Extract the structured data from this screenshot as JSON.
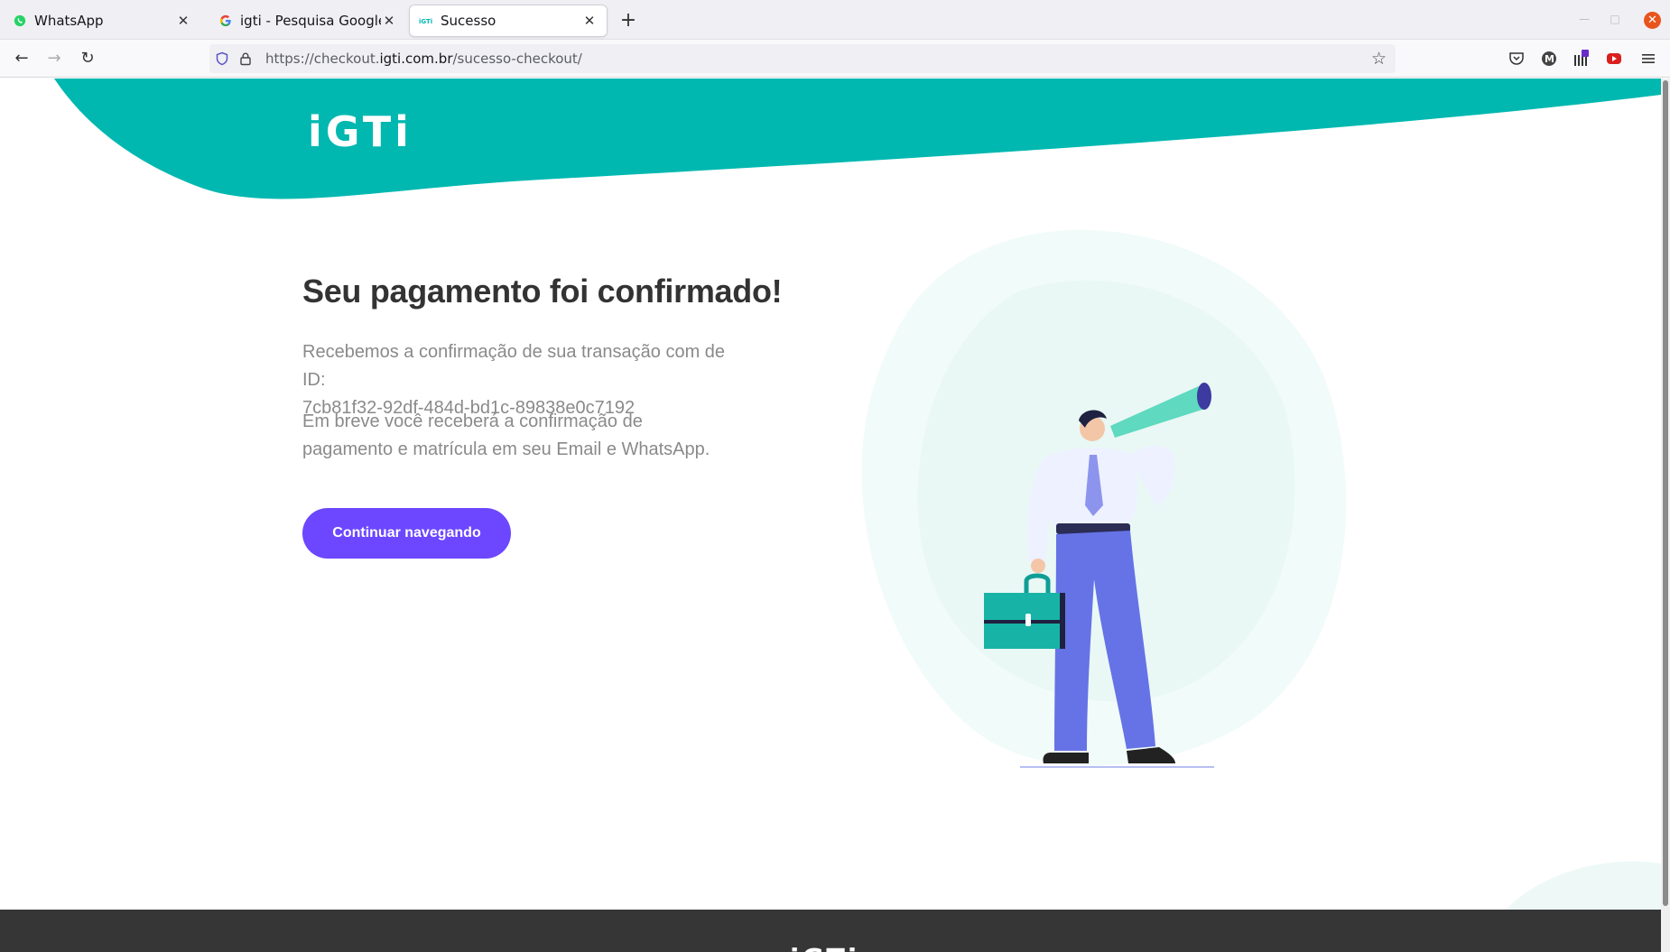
{
  "browser": {
    "tabs": [
      {
        "title": "WhatsApp",
        "favicon": "whatsapp-icon"
      },
      {
        "title": "igti - Pesquisa Google",
        "favicon": "google-icon"
      },
      {
        "title": "Sucesso",
        "favicon": "igti-icon",
        "active": true
      }
    ],
    "url": {
      "prefix": "https://checkout.",
      "host": "igti.com.br",
      "path": "/sucesso-checkout/"
    }
  },
  "page": {
    "brand": "iGTi",
    "title": "Seu pagamento foi confirmado!",
    "message_line1": "Recebemos a confirmação de sua transação com de ID:",
    "transaction_id": "7cb81f32-92df-484d-bd1c-89838e0c7192",
    "message2": "Em breve você receberá a confirmação de pagamento e matrícula em seu Email e WhatsApp.",
    "cta_label": "Continuar navegando"
  },
  "colors": {
    "teal": "#00b8b0",
    "button": "#6c47ff",
    "footer": "#363636"
  }
}
